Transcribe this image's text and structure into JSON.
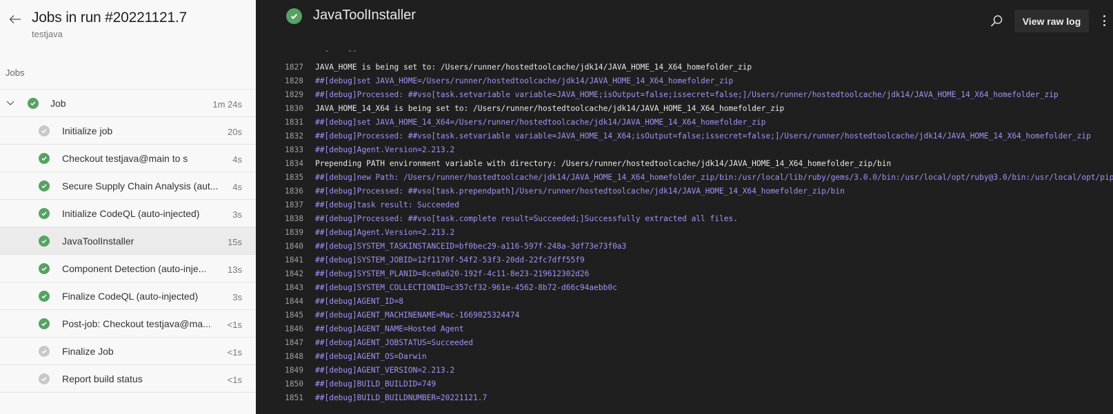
{
  "left": {
    "title": "Jobs in run #20221121.7",
    "subtitle": "testjava",
    "section_label": "Jobs",
    "job": {
      "name": "Job",
      "duration": "1m 24s",
      "status": "succeeded",
      "expanded": true
    },
    "steps": [
      {
        "name": "Initialize job",
        "duration": "20s",
        "status": "skipped"
      },
      {
        "name": "Checkout testjava@main to s",
        "duration": "4s",
        "status": "succeeded"
      },
      {
        "name": "Secure Supply Chain Analysis (aut...",
        "duration": "4s",
        "status": "succeeded"
      },
      {
        "name": "Initialize CodeQL (auto-injected)",
        "duration": "3s",
        "status": "succeeded"
      },
      {
        "name": "JavaToolInstaller",
        "duration": "15s",
        "status": "succeeded",
        "selected": true
      },
      {
        "name": "Component Detection (auto-inje...",
        "duration": "13s",
        "status": "succeeded"
      },
      {
        "name": "Finalize CodeQL (auto-injected)",
        "duration": "3s",
        "status": "succeeded"
      },
      {
        "name": "Post-job: Checkout testjava@ma...",
        "duration": "<1s",
        "status": "succeeded"
      },
      {
        "name": "Finalize Job",
        "duration": "<1s",
        "status": "skipped"
      },
      {
        "name": "Report build status",
        "duration": "<1s",
        "status": "skipped"
      }
    ]
  },
  "right": {
    "title": "JavaToolInstaller",
    "status": "succeeded",
    "view_raw_log_label": "View raw log",
    "icons": {
      "search": "search-icon",
      "more": "more-vertical-icon",
      "status": "check-circle-icon",
      "back": "arrow-left-icon"
    },
    "log_lines": [
      {
        "n": "1827",
        "text": "JAVA_HOME is being set to: /Users/runner/hostedtoolcache/jdk14/JAVA_HOME_14_X64_homefolder_zip",
        "debug": false
      },
      {
        "n": "1828",
        "text": "##[debug]set JAVA_HOME=/Users/runner/hostedtoolcache/jdk14/JAVA_HOME_14_X64_homefolder_zip",
        "debug": true
      },
      {
        "n": "1829",
        "text": "##[debug]Processed: ##vso[task.setvariable variable=JAVA_HOME;isOutput=false;issecret=false;]/Users/runner/hostedtoolcache/jdk14/JAVA_HOME_14_X64_homefolder_zip",
        "debug": true
      },
      {
        "n": "1830",
        "text": "JAVA_HOME_14_X64 is being set to: /Users/runner/hostedtoolcache/jdk14/JAVA_HOME_14_X64_homefolder_zip",
        "debug": false
      },
      {
        "n": "1831",
        "text": "##[debug]set JAVA_HOME_14_X64=/Users/runner/hostedtoolcache/jdk14/JAVA_HOME_14_X64_homefolder_zip",
        "debug": true
      },
      {
        "n": "1832",
        "text": "##[debug]Processed: ##vso[task.setvariable variable=JAVA_HOME_14_X64;isOutput=false;issecret=false;]/Users/runner/hostedtoolcache/jdk14/JAVA_HOME_14_X64_homefolder_zip",
        "debug": true
      },
      {
        "n": "1833",
        "text": "##[debug]Agent.Version=2.213.2",
        "debug": true
      },
      {
        "n": "1834",
        "text": "Prepending PATH environment variable with directory: /Users/runner/hostedtoolcache/jdk14/JAVA_HOME_14_X64_homefolder_zip/bin",
        "debug": false
      },
      {
        "n": "1835",
        "text": "##[debug]new Path: /Users/runner/hostedtoolcache/jdk14/JAVA_HOME_14_X64_homefolder_zip/bin:/usr/local/lib/ruby/gems/3.0.0/bin:/usr/local/opt/ruby@3.0/bin:/usr/local/opt/pipx_bin",
        "debug": true
      },
      {
        "n": "1836",
        "text": "##[debug]Processed: ##vso[task.prependpath]/Users/runner/hostedtoolcache/jdk14/JAVA_HOME_14_X64_homefolder_zip/bin",
        "debug": true
      },
      {
        "n": "1837",
        "text": "##[debug]task result: Succeeded",
        "debug": true
      },
      {
        "n": "1838",
        "text": "##[debug]Processed: ##vso[task.complete result=Succeeded;]Successfully extracted all files.",
        "debug": true
      },
      {
        "n": "1839",
        "text": "##[debug]Agent.Version=2.213.2",
        "debug": true
      },
      {
        "n": "1840",
        "text": "##[debug]SYSTEM_TASKINSTANCEID=bf0bec29-a116-597f-248a-3df73e73f0a3",
        "debug": true
      },
      {
        "n": "1841",
        "text": "##[debug]SYSTEM_JOBID=12f1170f-54f2-53f3-20dd-22fc7dff55f9",
        "debug": true
      },
      {
        "n": "1842",
        "text": "##[debug]SYSTEM_PLANID=8ce0a620-192f-4c11-8e23-219612302d26",
        "debug": true
      },
      {
        "n": "1843",
        "text": "##[debug]SYSTEM_COLLECTIONID=c357cf32-961e-4562-8b72-d66c94aebb0c",
        "debug": true
      },
      {
        "n": "1844",
        "text": "##[debug]AGENT_ID=8",
        "debug": true
      },
      {
        "n": "1845",
        "text": "##[debug]AGENT_MACHINENAME=Mac-1669025324474",
        "debug": true
      },
      {
        "n": "1846",
        "text": "##[debug]AGENT_NAME=Hosted Agent",
        "debug": true
      },
      {
        "n": "1847",
        "text": "##[debug]AGENT_JOBSTATUS=Succeeded",
        "debug": true
      },
      {
        "n": "1848",
        "text": "##[debug]AGENT_OS=Darwin",
        "debug": true
      },
      {
        "n": "1849",
        "text": "##[debug]AGENT_VERSION=2.213.2",
        "debug": true
      },
      {
        "n": "1850",
        "text": "##[debug]BUILD_BUILDID=749",
        "debug": true
      },
      {
        "n": "1851",
        "text": "##[debug]BUILD_BUILDNUMBER=20221121.7",
        "debug": true
      }
    ]
  },
  "colors": {
    "success": "#55a362",
    "skipped": "#c8c8c8",
    "log_debug": "#a592f7",
    "log_text": "#e8e8e8",
    "log_bg": "#1f1f1f",
    "sidebar_bg": "#f8f8f8"
  }
}
